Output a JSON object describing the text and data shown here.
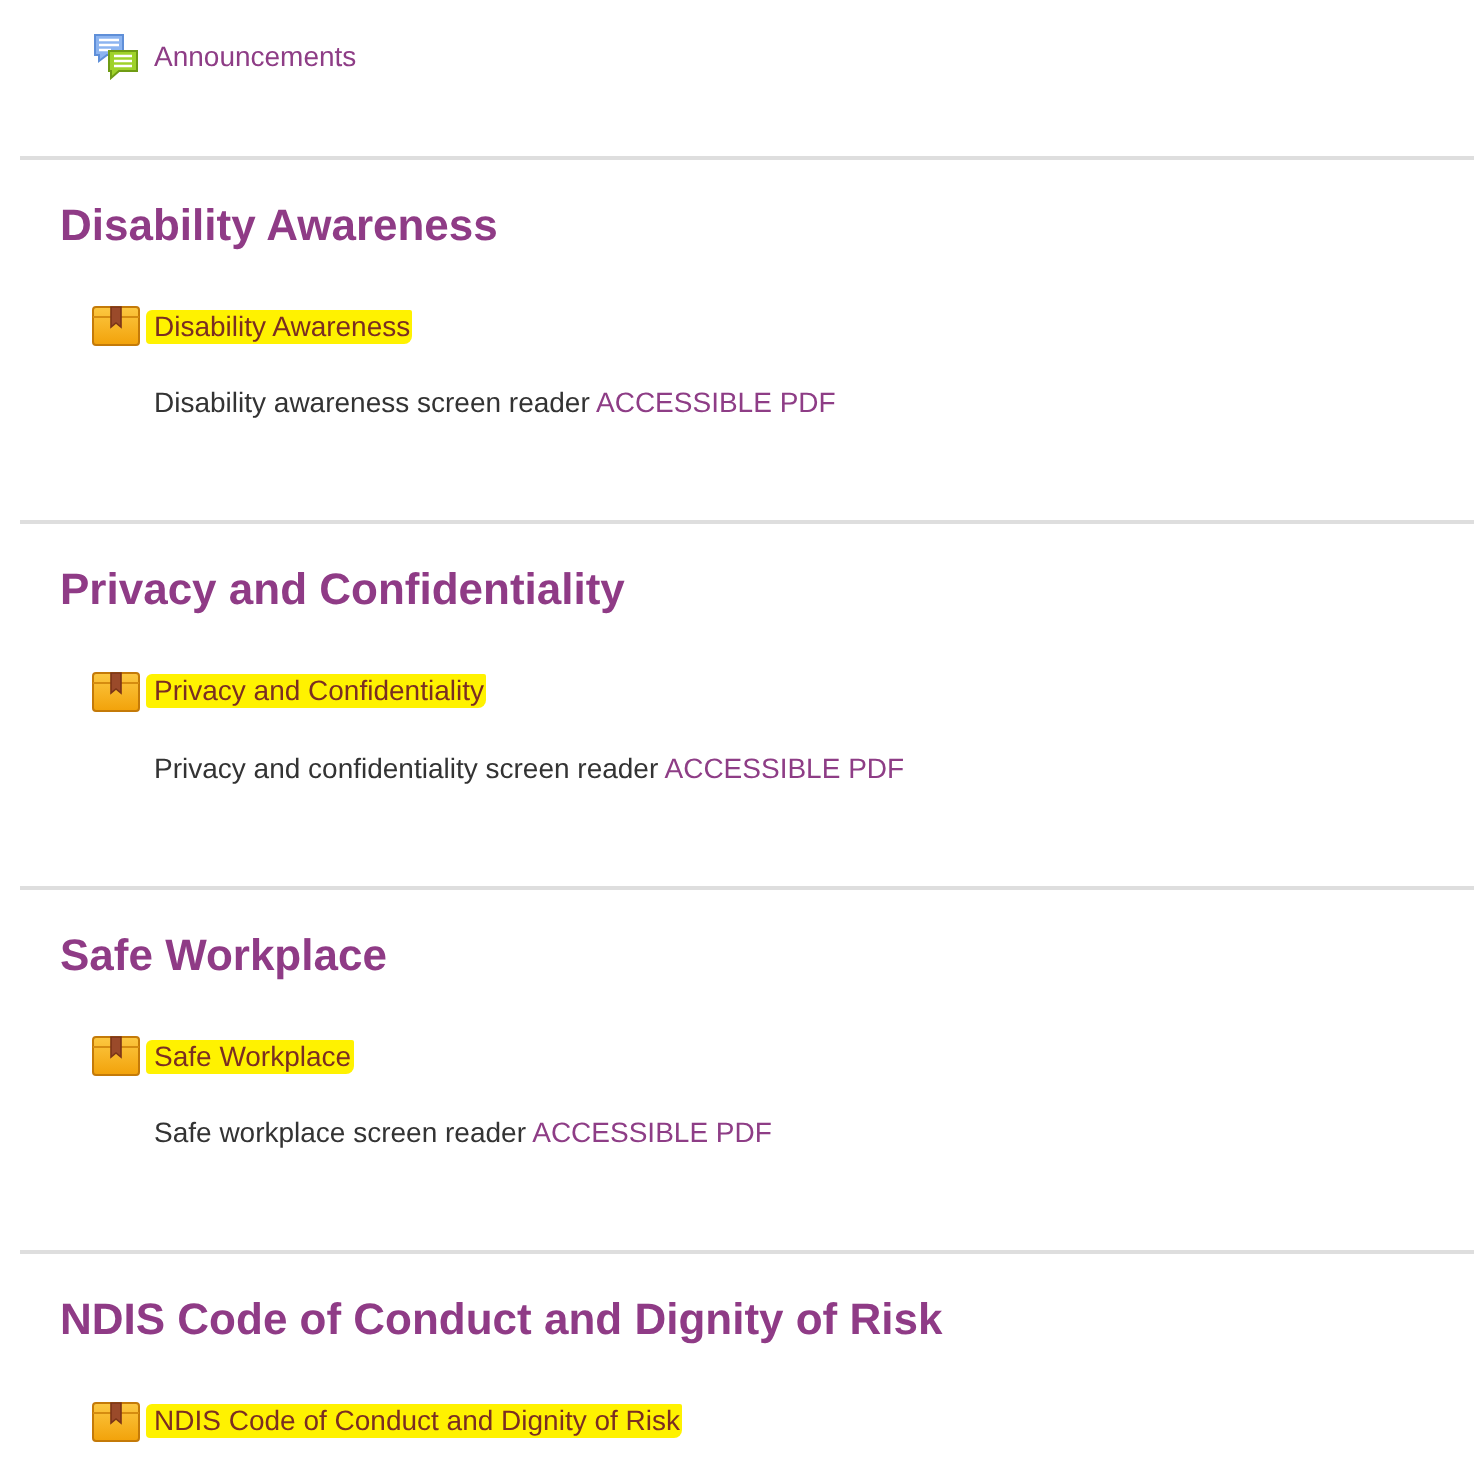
{
  "top_activities": [
    {
      "kind": "forum",
      "label": "Announcements"
    }
  ],
  "sections": [
    {
      "title": "Disability Awareness",
      "activities": [
        {
          "kind": "resource",
          "label": "Disability Awareness",
          "highlighted": true
        }
      ],
      "description": {
        "text": "Disability awareness screen reader",
        "link": "ACCESSIBLE PDF"
      }
    },
    {
      "title": "Privacy and Confidentiality",
      "activities": [
        {
          "kind": "resource",
          "label": "Privacy and Confidentiality",
          "highlighted": true
        }
      ],
      "description": {
        "text": "Privacy and confidentiality screen reader",
        "link": "ACCESSIBLE PDF"
      }
    },
    {
      "title": "Safe Workplace",
      "activities": [
        {
          "kind": "resource",
          "label": "Safe Workplace",
          "highlighted": true
        }
      ],
      "description": {
        "text": "Safe workplace screen reader",
        "link": "ACCESSIBLE PDF"
      }
    },
    {
      "title": "NDIS Code of Conduct and Dignity of Risk",
      "activities": [
        {
          "kind": "resource",
          "label": "NDIS Code of Conduct and Dignity of Risk",
          "highlighted": true
        }
      ]
    }
  ]
}
